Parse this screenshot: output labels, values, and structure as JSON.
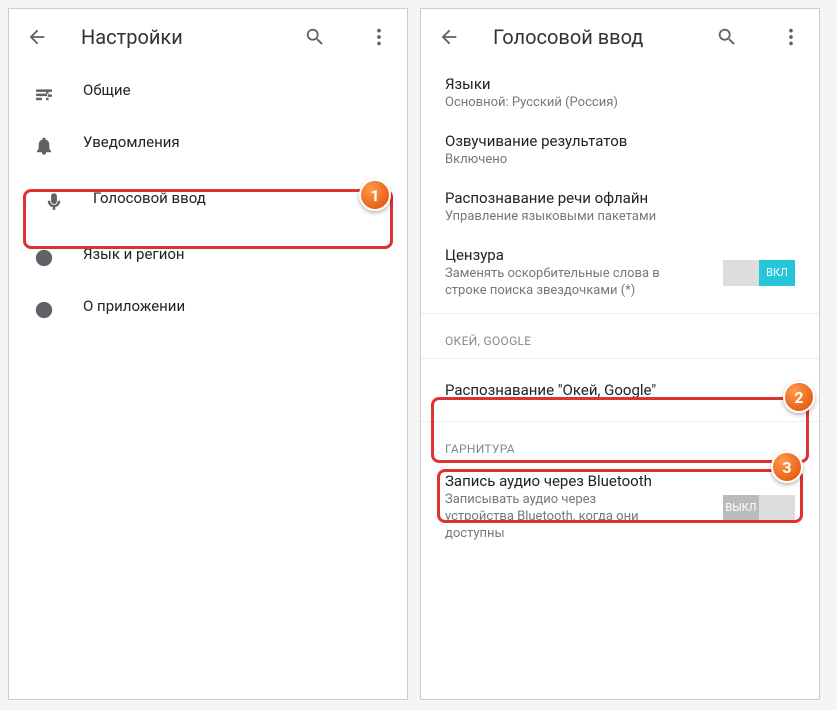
{
  "left": {
    "title": "Настройки",
    "items": [
      {
        "label": "Общие"
      },
      {
        "label": "Уведомления"
      },
      {
        "label": "Голосовой ввод"
      },
      {
        "label": "Язык и регион"
      },
      {
        "label": "О приложении"
      }
    ]
  },
  "right": {
    "title": "Голосовой ввод",
    "langs": {
      "label": "Языки",
      "sub": "Основной: Русский (Россия)"
    },
    "speak": {
      "label": "Озвучивание результатов",
      "sub": "Включено"
    },
    "offline": {
      "label": "Распознавание речи офлайн",
      "sub": "Управление языковыми пакетами"
    },
    "censor": {
      "label": "Цензура",
      "sub": "Заменять оскорбительные слова в строке поиска звездочками (*)",
      "toggle": "ВКЛ"
    },
    "section_ok": "ОКЕЙ, GOOGLE",
    "okgoogle": {
      "label": "Распознавание \"Окей, Google\""
    },
    "section_headset": "ГАРНИТУРА",
    "bt": {
      "label": "Запись аудио через Bluetooth",
      "sub": "Записывать аудио через устройства Bluetooth, когда они доступны",
      "toggle": "ВЫКЛ"
    }
  },
  "badges": {
    "b1": "1",
    "b2": "2",
    "b3": "3"
  }
}
